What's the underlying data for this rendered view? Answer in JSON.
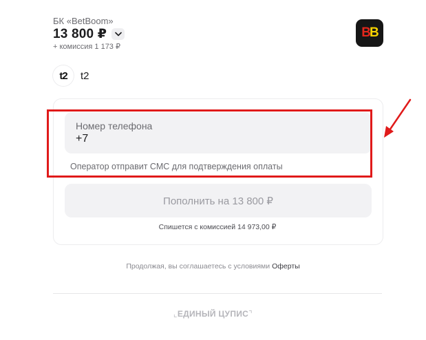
{
  "merchant": {
    "label": "БК «BetBoom»",
    "amount": "13 800 ₽",
    "commission": "+ комиссия 1 173 ₽",
    "logo_text_a": "B",
    "logo_text_b": "B"
  },
  "operator": {
    "logo_text": "t2",
    "name": "t2"
  },
  "form": {
    "phone_label": "Номер телефона",
    "phone_value": "+7",
    "sms_hint": "Оператор отправит СМС для подтверждения оплаты",
    "pay_button": "Пополнить на 13 800 ₽",
    "charge_note": "Спишется с комиссией 14 973,00 ₽"
  },
  "agreement": {
    "text": "Продолжая, вы соглашаетесь с условиями",
    "offer_link": "Оферты"
  },
  "footer": {
    "brand": "ЕДИНЫЙ ЦУПИС",
    "bracket_open": "⌞",
    "bracket_close": "⌝"
  },
  "colors": {
    "annotation_red": "#e01a1a",
    "bb_red": "#e3271c",
    "bb_yellow": "#f6d300"
  }
}
